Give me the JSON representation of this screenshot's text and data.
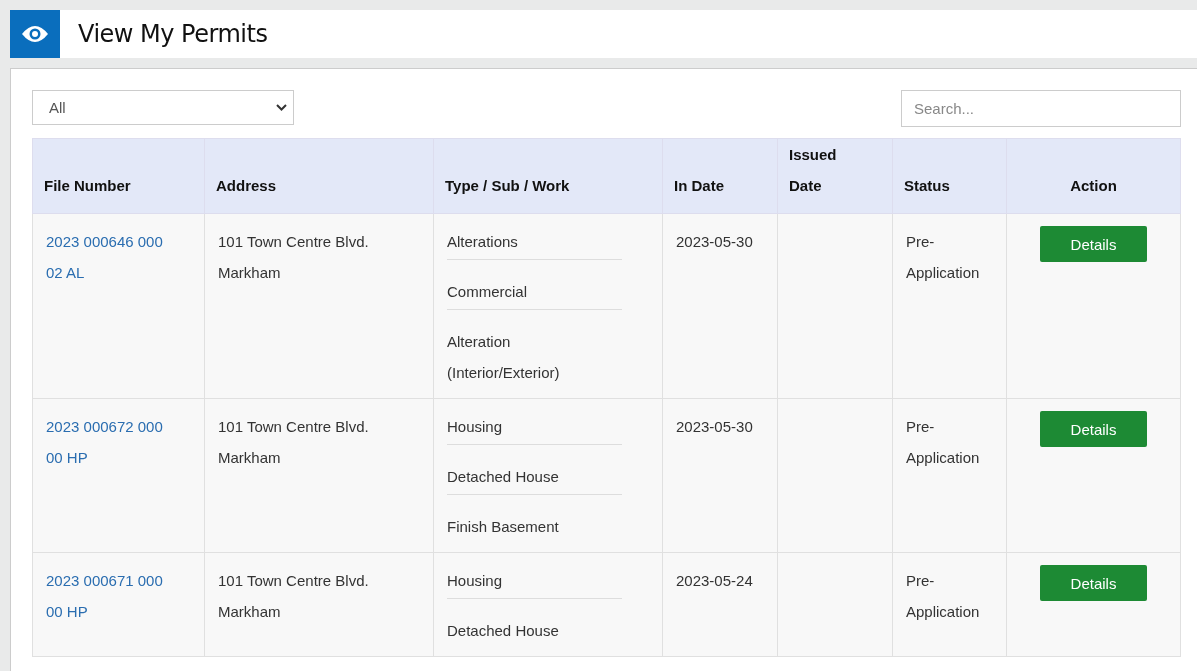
{
  "page": {
    "title": "View My Permits"
  },
  "filter": {
    "value": "All"
  },
  "search": {
    "placeholder": "Search..."
  },
  "table": {
    "columns": [
      "File Number",
      "Address",
      "Type / Sub / Work",
      "In Date",
      "Issued Date",
      "Status",
      "Action"
    ],
    "rows": [
      {
        "file_number": "2023 000646 000 02 AL",
        "address": "101 Town Centre Blvd. Markham",
        "types": [
          "Alterations",
          "Commercial",
          "Alteration (Interior/Exterior)"
        ],
        "in_date": "2023-05-30",
        "issued_date": "",
        "status": "Pre-Application",
        "action": "Details"
      },
      {
        "file_number": "2023 000672 000 00 HP",
        "address": "101 Town Centre Blvd. Markham",
        "types": [
          "Housing",
          "Detached House",
          "Finish Basement"
        ],
        "in_date": "2023-05-30",
        "issued_date": "",
        "status": "Pre-Application",
        "action": "Details"
      },
      {
        "file_number": "2023 000671 000 00 HP",
        "address": "101 Town Centre Blvd. Markham",
        "types": [
          "Housing",
          "Detached House"
        ],
        "in_date": "2023-05-24",
        "issued_date": "",
        "status": "Pre-Application",
        "action": "Details"
      }
    ]
  }
}
